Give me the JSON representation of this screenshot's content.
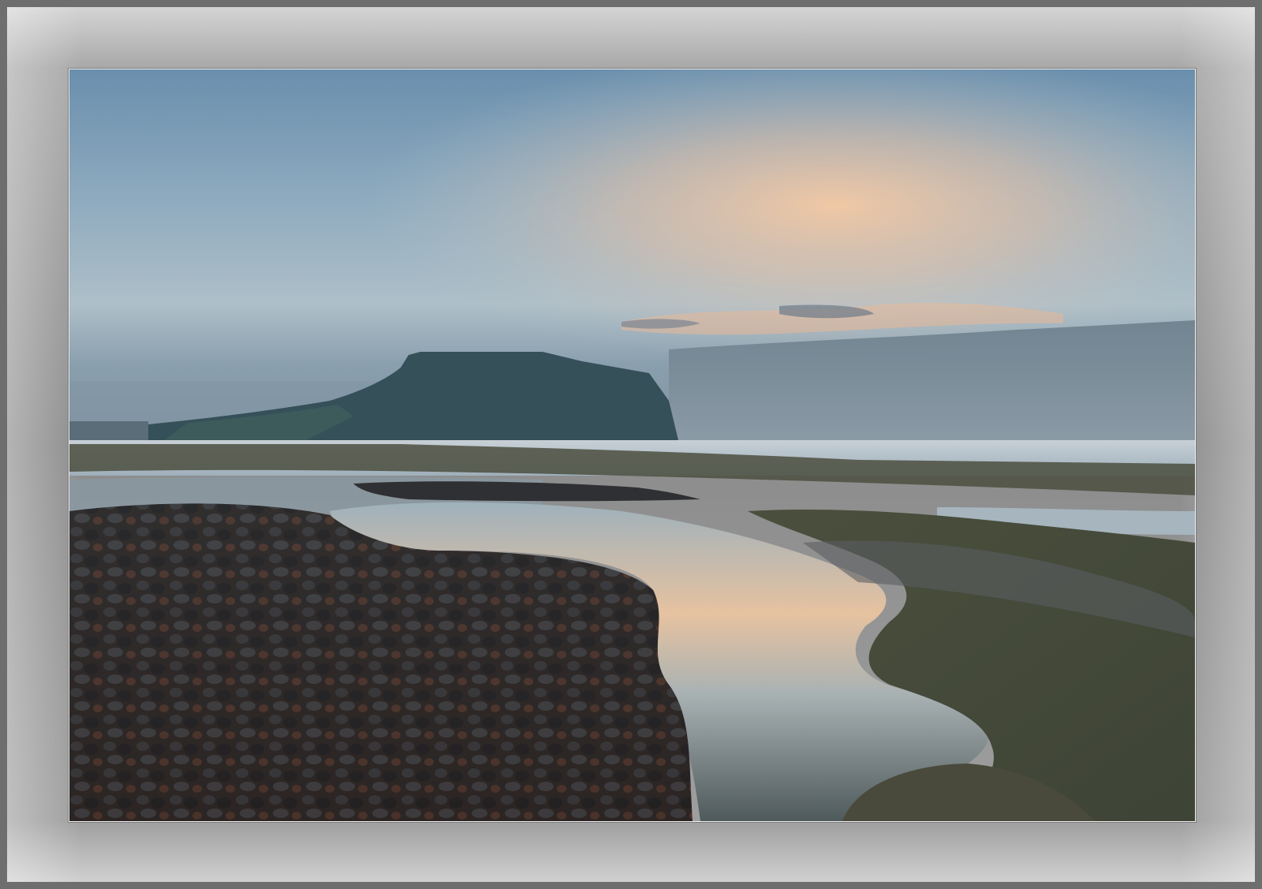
{
  "image": {
    "subject": "coastal-sunset-scene",
    "colors": {
      "frame": "#9a9a9a",
      "sky_top": "#6f93b0",
      "sky_glow": "#f2c49c",
      "headland": "#37525a",
      "sea": "#b9c6cf",
      "rock": "#2a2626"
    }
  }
}
